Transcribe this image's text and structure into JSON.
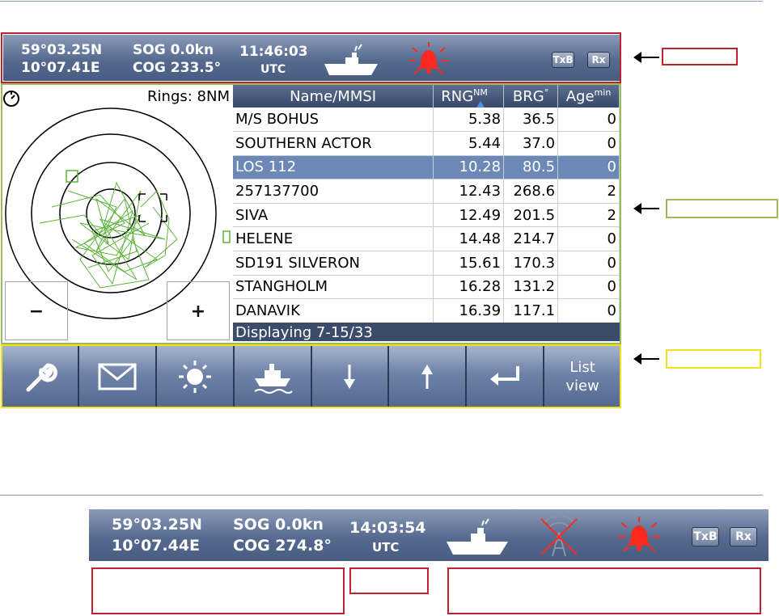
{
  "top_status": {
    "lat": "59°03.25N",
    "lon": "10°07.41E",
    "sog": "SOG 0.0kn",
    "cog": "COG 233.5°",
    "time": "11:46:03",
    "tz": "UTC",
    "tx": "TxB",
    "rx": "Rx"
  },
  "plot": {
    "rings_label": "Rings: 8NM",
    "zoom_out": "−",
    "zoom_in": "+"
  },
  "list": {
    "headers": {
      "name": "Name/MMSI",
      "rng": "RNG",
      "rng_unit": "NM",
      "brg": "BRG",
      "brg_unit": "°",
      "age": "Age",
      "age_unit": "min"
    },
    "rows": [
      {
        "name": "M/S BOHUS",
        "rng": "5.38",
        "brg": "36.5",
        "age": "0"
      },
      {
        "name": "SOUTHERN ACTOR",
        "rng": "5.44",
        "brg": "37.0",
        "age": "0"
      },
      {
        "name": "LOS 112",
        "rng": "10.28",
        "brg": "80.5",
        "age": "0"
      },
      {
        "name": "257137700",
        "rng": "12.43",
        "brg": "268.6",
        "age": "2"
      },
      {
        "name": "SIVA",
        "rng": "12.49",
        "brg": "201.5",
        "age": "2"
      },
      {
        "name": "HELENE",
        "rng": "14.48",
        "brg": "214.7",
        "age": "0"
      },
      {
        "name": "SD191 SILVERON",
        "rng": "15.61",
        "brg": "170.3",
        "age": "0"
      },
      {
        "name": "STANGHOLM",
        "rng": "16.28",
        "brg": "131.2",
        "age": "0"
      },
      {
        "name": "DANAVIK",
        "rng": "16.39",
        "brg": "117.1",
        "age": "0"
      }
    ],
    "selected_index": 2,
    "footer": "Displaying 7-15/33"
  },
  "toolbar": {
    "buttons": [
      {
        "icon": "wrench-icon"
      },
      {
        "icon": "envelope-icon"
      },
      {
        "icon": "sun-icon"
      },
      {
        "icon": "ship-icon"
      },
      {
        "icon": "arrow-down-icon"
      },
      {
        "icon": "arrow-up-icon"
      },
      {
        "icon": "enter-icon"
      },
      {
        "label_line1": "List",
        "label_line2": "view"
      }
    ]
  },
  "bottom_status": {
    "lat": "59°03.25N",
    "lon": "10°07.44E",
    "sog": "SOG 0.0kn",
    "cog": "COG 274.8°",
    "time": "14:03:54",
    "tz": "UTC",
    "tx": "TxB",
    "rx": "Rx"
  },
  "colors": {
    "alarm_red": "#ff2a1f",
    "plot_track_green": "#5cb43a",
    "highlight_row": "#6c88b7"
  }
}
